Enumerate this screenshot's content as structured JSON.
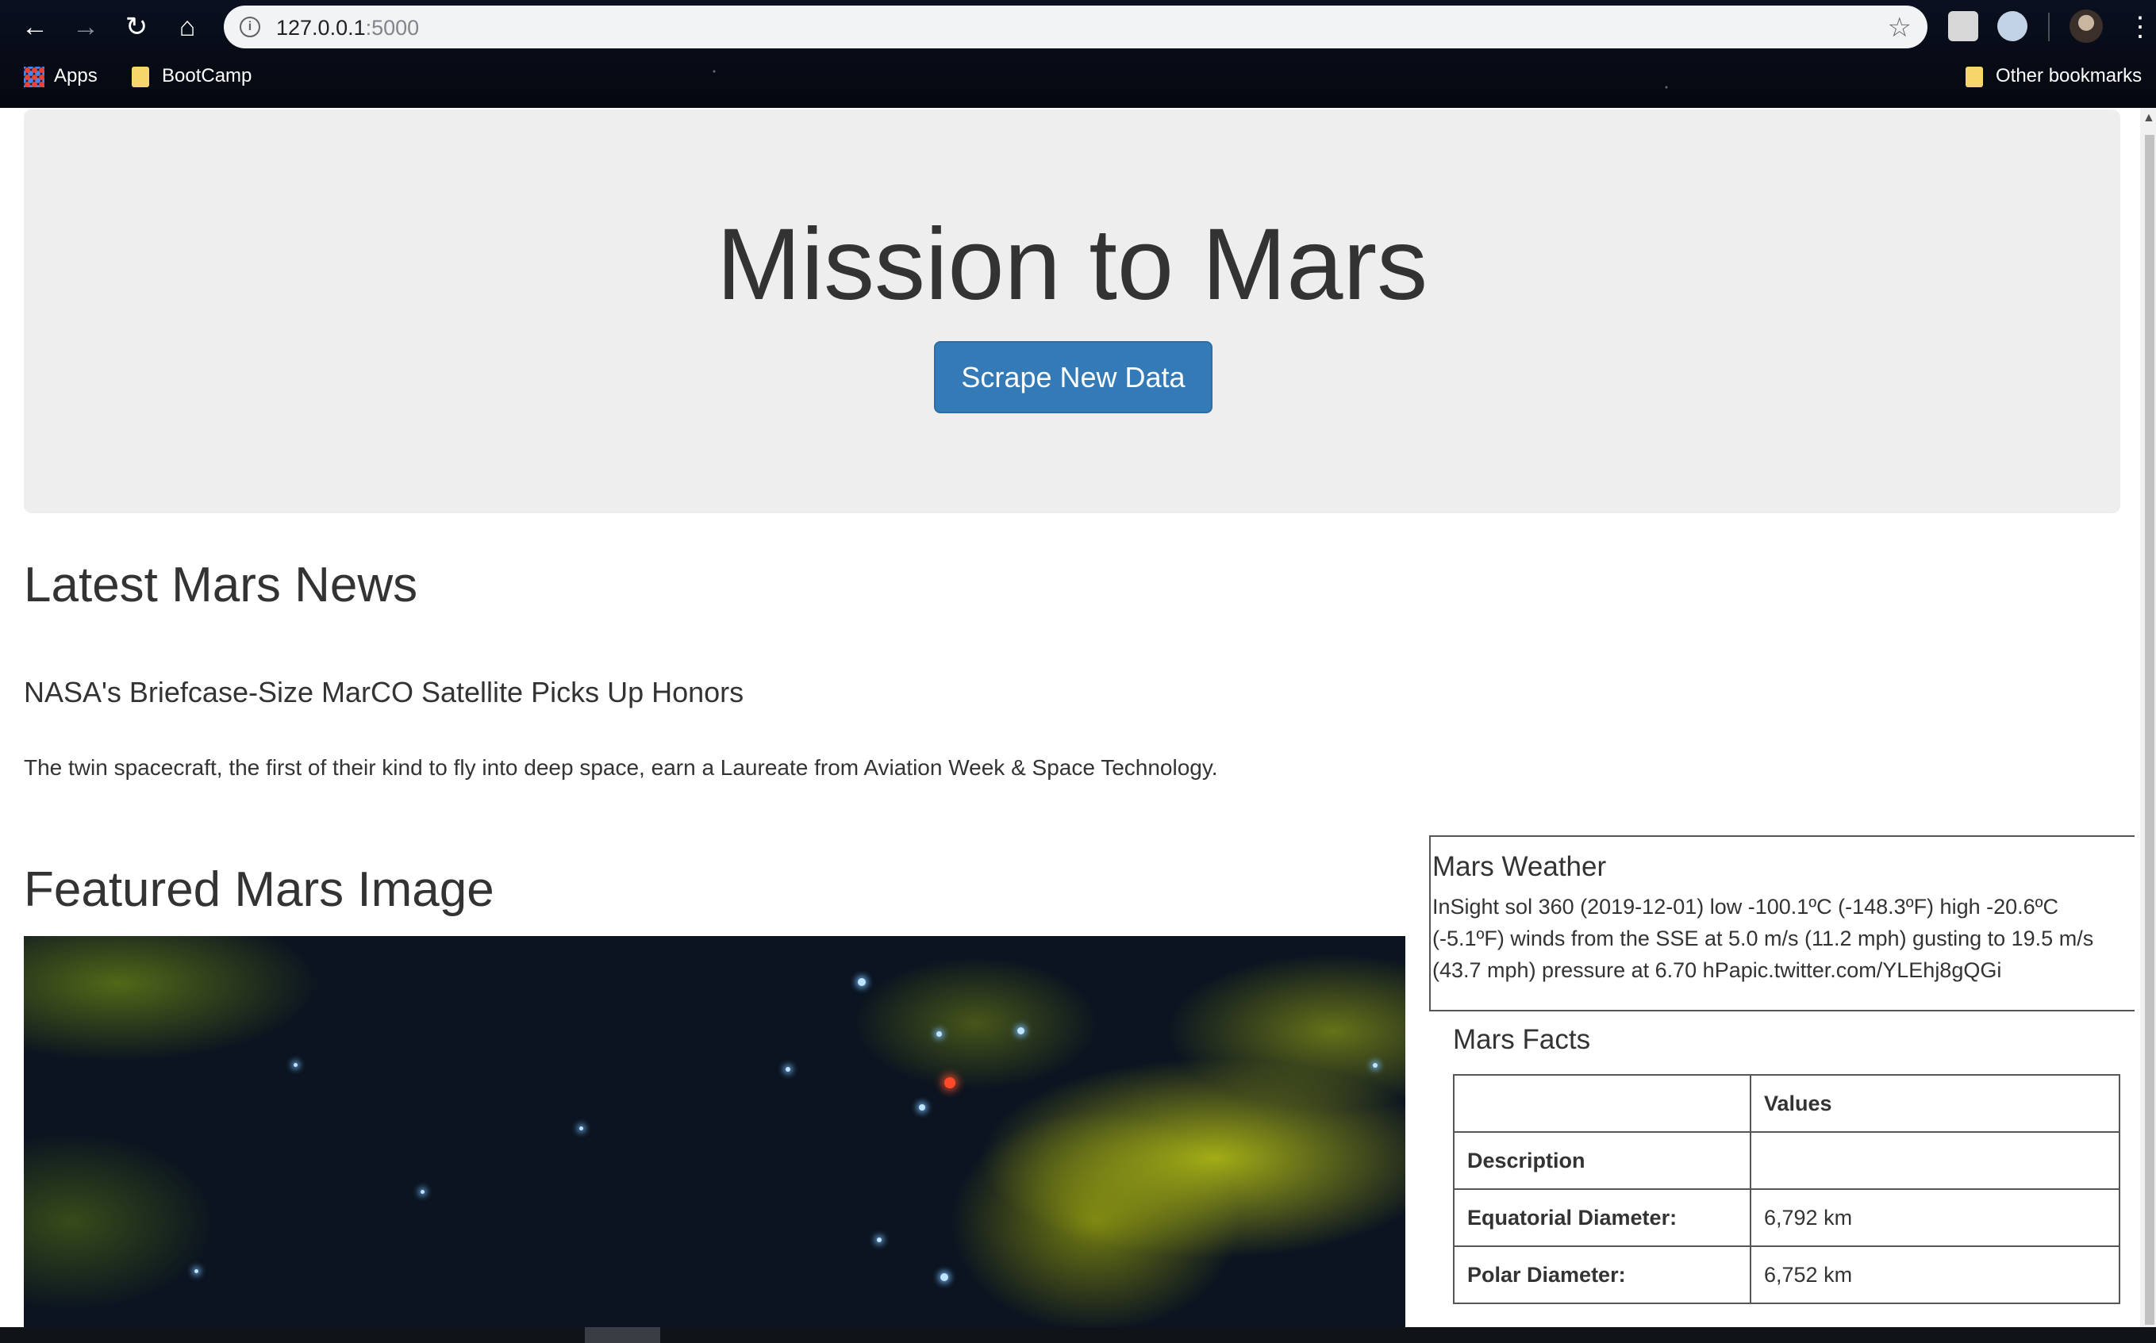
{
  "browser": {
    "url_host": "127.0.0.1",
    "url_port": ":5000",
    "bookmarks": {
      "apps_label": "Apps",
      "bootcamp_label": "BootCamp",
      "other_label": "Other bookmarks"
    }
  },
  "page": {
    "jumbotron": {
      "title": "Mission to Mars",
      "button_label": "Scrape New Data"
    },
    "news": {
      "heading": "Latest Mars News",
      "title": "NASA's Briefcase-Size MarCO Satellite Picks Up Honors",
      "paragraph": "The twin spacecraft, the first of their kind to fly into deep space, earn a Laureate from Aviation Week & Space Technology."
    },
    "featured_image": {
      "heading": "Featured Mars Image"
    },
    "weather": {
      "heading": "Mars Weather",
      "text": "InSight sol 360 (2019-12-01) low -100.1ºC (-148.3ºF) high -20.6ºC (-5.1ºF) winds from the SSE at 5.0 m/s (11.2 mph) gusting to 19.5 m/s (43.7 mph) pressure at 6.70 hPapic.twitter.com/YLEhj8gQGi"
    },
    "facts": {
      "heading": "Mars Facts",
      "columns": [
        "",
        "Values"
      ],
      "rows": [
        {
          "label": "Description",
          "value": ""
        },
        {
          "label": "Equatorial Diameter:",
          "value": "6,792 km"
        },
        {
          "label": "Polar Diameter:",
          "value": "6,752 km"
        }
      ]
    }
  },
  "colors": {
    "primary_button": "#337ab7",
    "jumbotron_bg": "#eeeeee",
    "text": "#333333"
  }
}
